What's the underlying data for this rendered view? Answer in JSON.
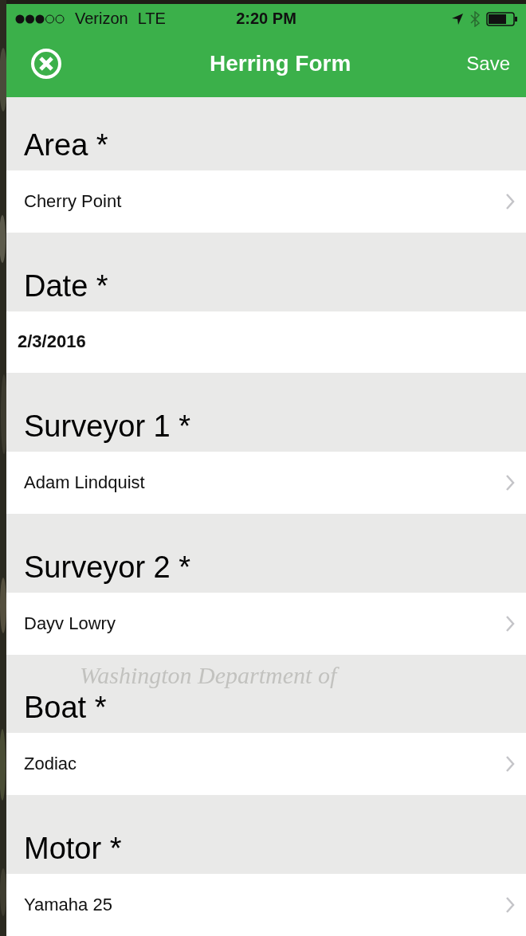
{
  "status_bar": {
    "carrier": "Verizon",
    "network": "LTE",
    "time": "2:20 PM"
  },
  "nav": {
    "title": "Herring Form",
    "action": "Save"
  },
  "fields": [
    {
      "label": "Area *",
      "kind": "select",
      "value": "Cherry Point"
    },
    {
      "label": "Date *",
      "kind": "date",
      "value": "2/3/2016"
    },
    {
      "label": "Surveyor 1 *",
      "kind": "select",
      "value": "Adam Lindquist"
    },
    {
      "label": "Surveyor 2 *",
      "kind": "select",
      "value": "Dayv Lowry"
    },
    {
      "label": "Boat *",
      "kind": "select",
      "value": "Zodiac",
      "emblem_text": "Washington Department of"
    },
    {
      "label": "Motor *",
      "kind": "select",
      "value": "Yamaha 25"
    }
  ]
}
